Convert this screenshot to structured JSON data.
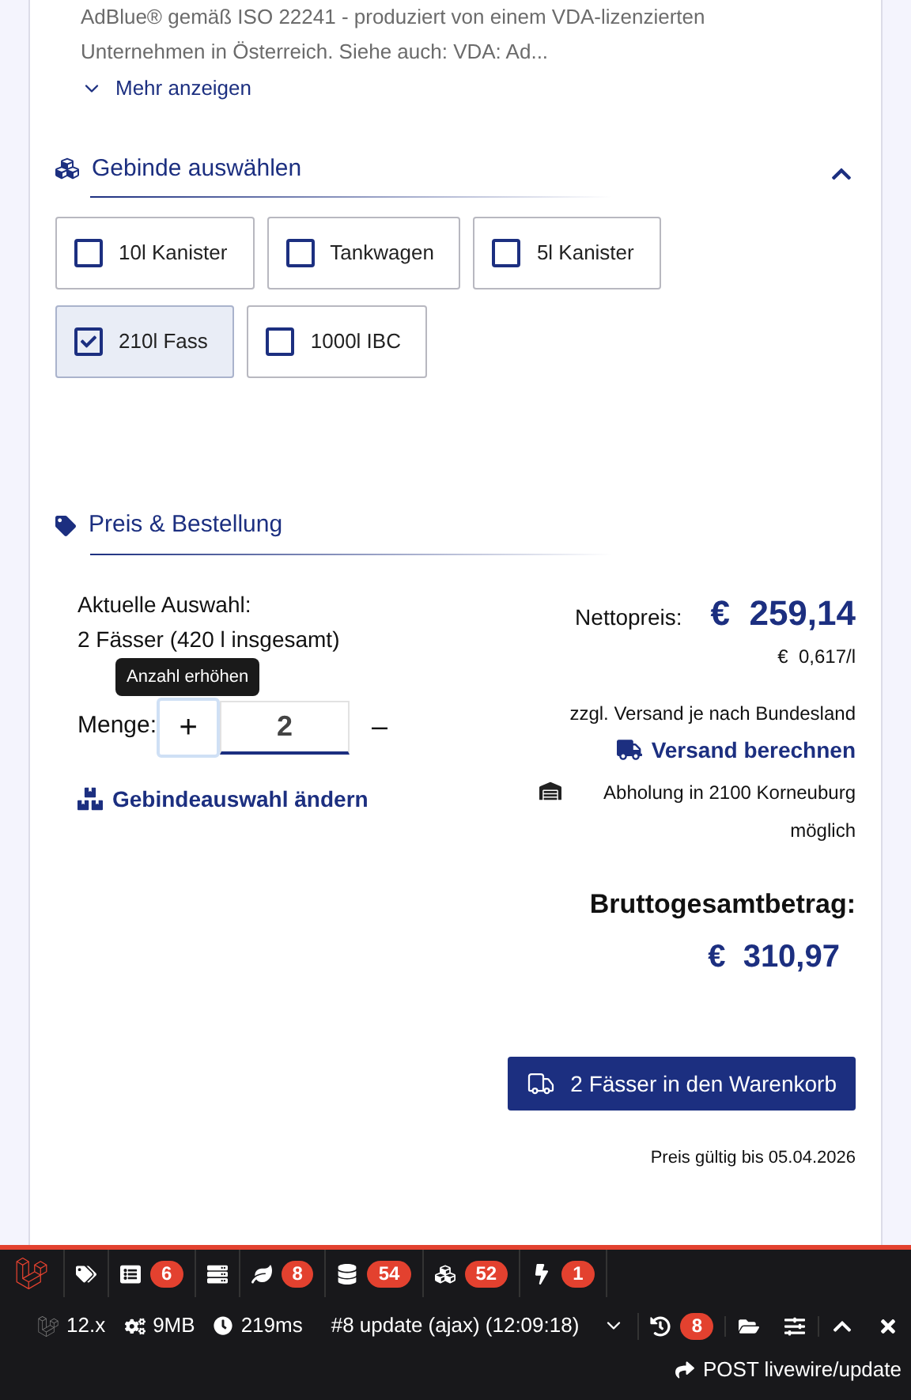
{
  "description": {
    "lines": [
      "AdBlue® gemäß ISO 22241 - produziert von einem VDA-lizenzierten",
      "Unternehmen in Österreich. Siehe auch: VDA: Ad..."
    ],
    "more": "Mehr anzeigen"
  },
  "containers": {
    "title": "Gebinde auswählen",
    "expanded": true,
    "options": [
      {
        "label": "10l Kanister",
        "checked": false
      },
      {
        "label": "Tankwagen",
        "checked": false
      },
      {
        "label": "5l Kanister",
        "checked": false
      },
      {
        "label": "210l Fass",
        "checked": true
      },
      {
        "label": "1000l IBC",
        "checked": false
      }
    ]
  },
  "order": {
    "title": "Preis & Bestellung",
    "selection_label": "Aktuelle Auswahl:",
    "selection_value": "2 Fässer (420 l insgesamt)",
    "quantity_label": "Menge:",
    "quantity": "2",
    "plus": "+",
    "minus": "–",
    "tooltip": "Anzahl erhöhen",
    "change_link": "Gebindeauswahl ändern",
    "net_label": "Nettopreis:",
    "net_price": "€  259,14",
    "per_liter": "€  0,617/l",
    "shipping_note": "zzgl. Versand je nach Bundesland",
    "shipping_link": "Versand berechnen",
    "pickup": "Abholung in 2100 Korneuburg möglich",
    "gross_label": "Bruttogesamtbetrag:",
    "gross_price": "€  310,97",
    "cart_button": "2 Fässer in den Warenkorb",
    "valid_until": "Preis gültig bis 05.04.2026"
  },
  "debugbar": {
    "tabs": [
      {
        "kind": "tags"
      },
      {
        "kind": "messages",
        "badge": "6"
      },
      {
        "kind": "routes"
      },
      {
        "kind": "views",
        "badge": "8"
      },
      {
        "kind": "queries",
        "badge": "54"
      },
      {
        "kind": "models",
        "badge": "52"
      },
      {
        "kind": "events",
        "badge": "1"
      }
    ],
    "version": "12.x",
    "memory": "9MB",
    "duration": "219ms",
    "request": "#8 update (ajax) (12:09:18)",
    "history_badge": "8",
    "route": "POST livewire/update"
  }
}
